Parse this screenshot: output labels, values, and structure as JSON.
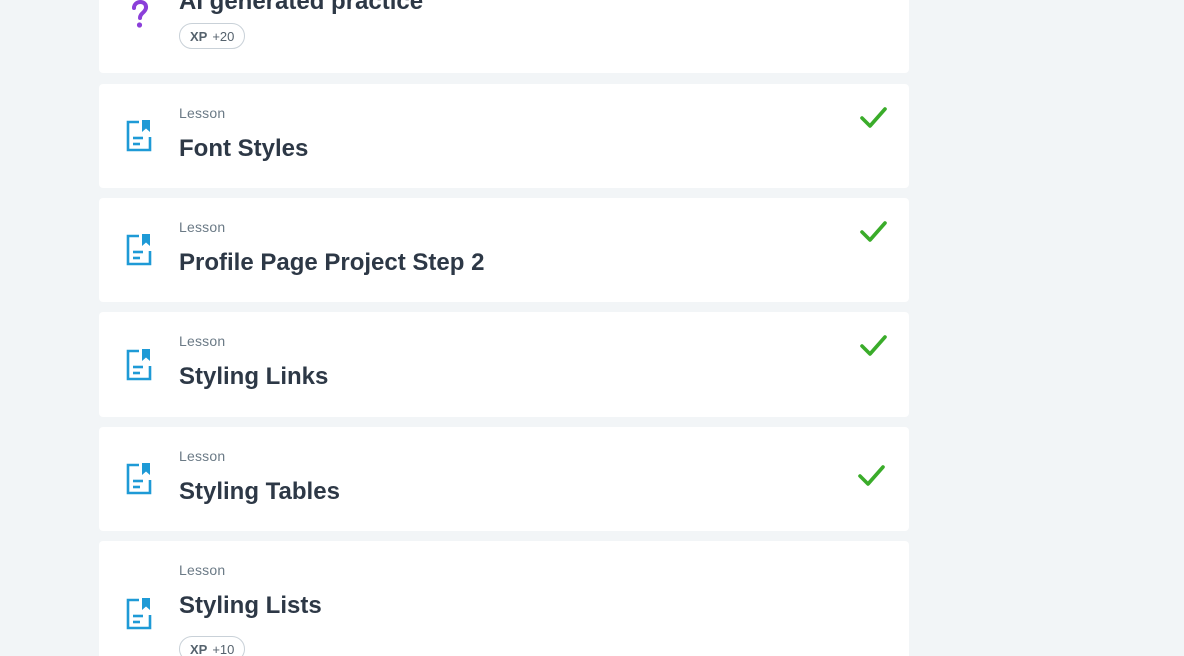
{
  "colors": {
    "background": "#f2f5f7",
    "card": "#ffffff",
    "lesson_icon": "#1e9ad6",
    "practice_icon": "#8b3fd9",
    "check": "#3aac2a",
    "title": "#2d3846",
    "meta": "#6b7a86"
  },
  "items": [
    {
      "title": "AI generated practice",
      "icon": "question-icon",
      "xp_label": "XP",
      "xp_value": "+20"
    },
    {
      "type": "Lesson",
      "title": "Font Styles",
      "icon": "lesson-doc-icon",
      "completed": true
    },
    {
      "type": "Lesson",
      "title": "Profile Page Project Step 2",
      "icon": "lesson-doc-icon",
      "completed": true
    },
    {
      "type": "Lesson",
      "title": "Styling Links",
      "icon": "lesson-doc-icon",
      "completed": true
    },
    {
      "type": "Lesson",
      "title": "Styling Tables",
      "icon": "lesson-doc-icon",
      "completed": true
    },
    {
      "type": "Lesson",
      "title": "Styling Lists",
      "icon": "lesson-doc-icon",
      "completed": false,
      "xp_label": "XP",
      "xp_value": "+10"
    }
  ]
}
